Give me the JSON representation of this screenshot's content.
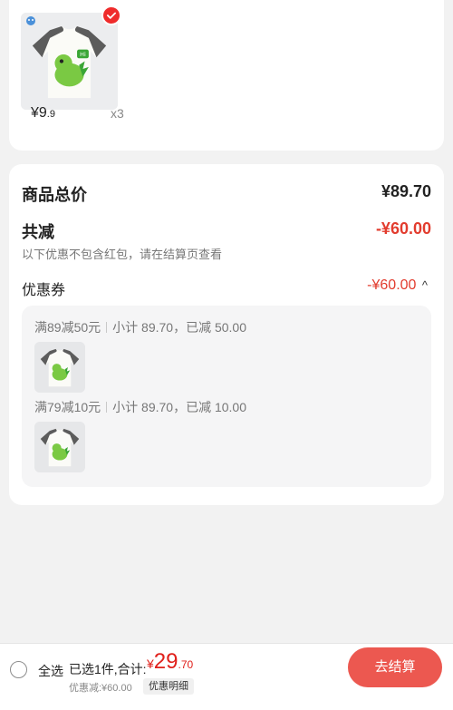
{
  "item": {
    "price_int": "¥9",
    "price_dec": ".9",
    "quantity": "x3",
    "image": "white t-shirt with grey sleeves and green dinosaur print"
  },
  "summary": {
    "subtotal_label": "商品总价",
    "subtotal_value": "¥89.70",
    "discount_label": "共减",
    "discount_value": "-¥60.00",
    "discount_note": "以下优惠不包含红包，请在结算页查看",
    "coupon_label": "优惠券",
    "coupon_value": "-¥60.00",
    "coupon_chevron": "^",
    "coupons": [
      {
        "rule": "满89减50元",
        "detail": "小计 89.70，已减 50.00"
      },
      {
        "rule": "满79减10元",
        "detail": "小计 89.70，已减 10.00"
      }
    ]
  },
  "bottom_bar": {
    "select_all": "全选",
    "total_label": "已选1件,合计:",
    "total_currency": "¥",
    "total_int": "29",
    "total_dec": ".70",
    "discount_line": "优惠减:¥60.00",
    "detail_button": "优惠明细",
    "checkout_button": "去结算"
  },
  "colors": {
    "accent_red": "#e23c2e",
    "checkout_red": "#e8342a"
  }
}
